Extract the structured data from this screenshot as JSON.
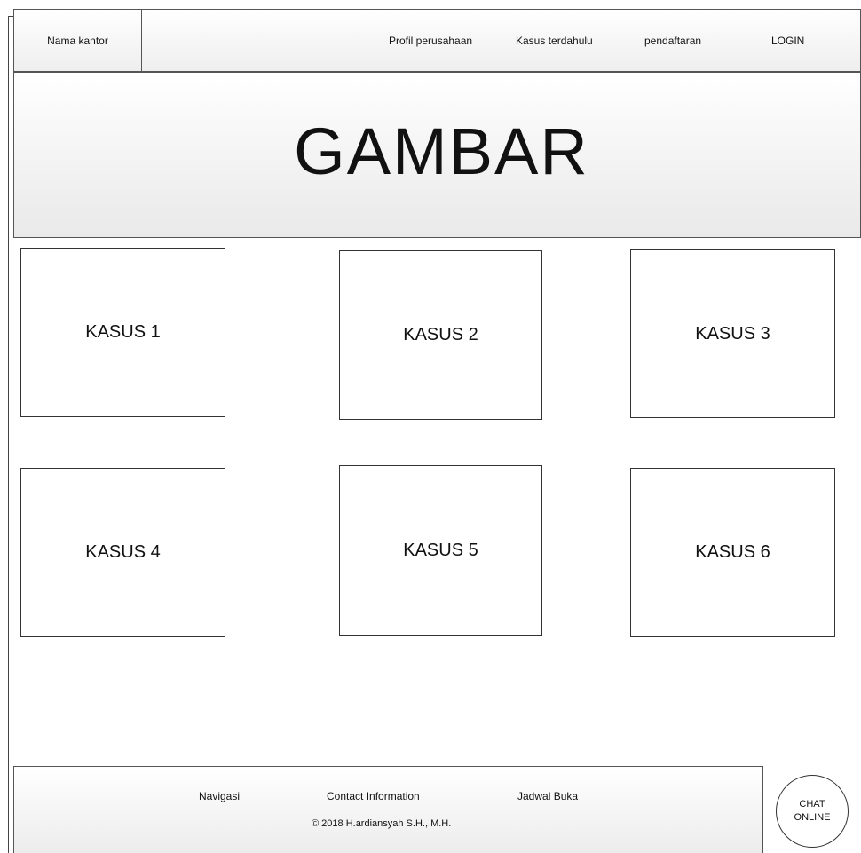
{
  "header": {
    "brand": "Nama kantor",
    "nav": [
      {
        "label": "Profil perusahaan"
      },
      {
        "label": "Kasus terdahulu"
      },
      {
        "label": "pendaftaran"
      },
      {
        "label": "LOGIN"
      }
    ]
  },
  "hero": {
    "text": "GAMBAR"
  },
  "cases": [
    {
      "label": "KASUS 1"
    },
    {
      "label": "KASUS 2"
    },
    {
      "label": "KASUS 3"
    },
    {
      "label": "KASUS 4"
    },
    {
      "label": "KASUS 5"
    },
    {
      "label": "KASUS 6"
    }
  ],
  "footer": {
    "links": [
      {
        "label": "Navigasi"
      },
      {
        "label": "Contact Information"
      },
      {
        "label": "Jadwal Buka"
      }
    ],
    "copyright": "© 2018 H.ardiansyah S.H., M.H."
  },
  "chat": {
    "line1": "CHAT",
    "line2": "ONLINE"
  }
}
